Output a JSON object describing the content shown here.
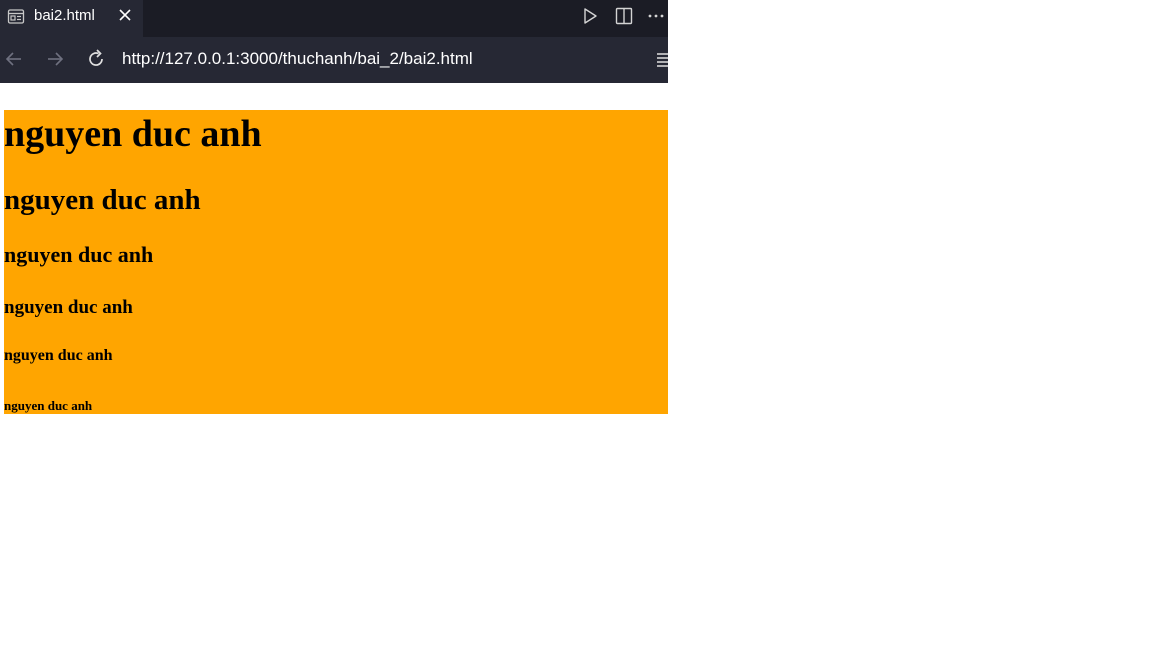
{
  "tab": {
    "title": "bai2.html",
    "icon": "preview-icon",
    "close_icon": "close-icon"
  },
  "toolbar": {
    "run_icon": "play-icon",
    "split_icon": "split-editor-icon",
    "more_icon": "more-icon"
  },
  "nav": {
    "back_icon": "back-arrow-icon",
    "forward_icon": "forward-arrow-icon",
    "reload_icon": "reload-icon",
    "url": "http://127.0.0.1:3000/thuchanh/bai_2/bai2.html",
    "menu_icon": "menu-icon"
  },
  "page": {
    "background": "#ffa500",
    "headings": [
      "nguyen duc anh",
      "nguyen duc anh",
      "nguyen duc anh",
      "nguyen duc anh",
      "nguyen duc anh",
      "nguyen duc anh"
    ]
  }
}
